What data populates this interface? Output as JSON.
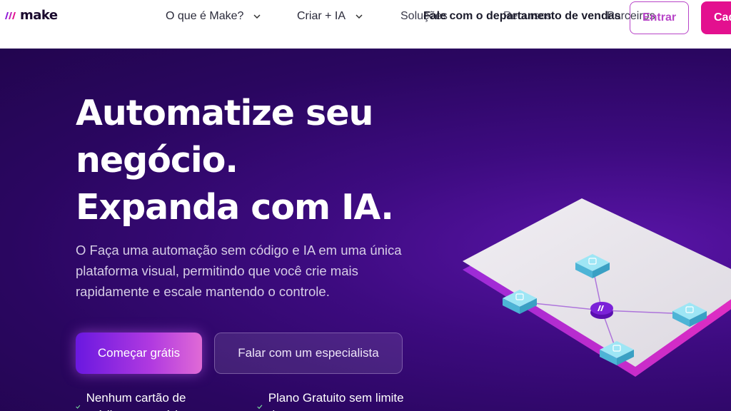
{
  "header": {
    "logo_text": "make",
    "nav": [
      {
        "label": "O que é Make?"
      },
      {
        "label": "Criar + IA"
      }
    ],
    "overlapping_nav": {
      "solucoes": "Soluções",
      "recursos": "Recursos",
      "parceiros": "Parceiros",
      "fale": "Fale com o departamento de vendas",
      "mais": "Entrar"
    },
    "login_label": "Entrar",
    "signup_label": "Cadastre-se"
  },
  "hero": {
    "title": "Automatize seu negócio. Expanda com IA.",
    "lead": "O Faça uma automação sem código e IA em uma única plataforma visual, permitindo que você crie mais rapidamente e escale mantendo o controle.",
    "primary_button": "Começar grátis",
    "secondary_button": "Falar com um especialista",
    "checks": [
      {
        "text": "Nenhum cartão de crédito necessário"
      },
      {
        "text": "Plano Gratuito sem limite de tempo"
      }
    ]
  },
  "colors": {
    "brand_pink": "#e3108f",
    "hero_purple": "#3d0b80",
    "node_blue": "#7fd3ea"
  },
  "icons": [
    "make-logo-icon",
    "chevron-down-icon",
    "checkmark-icon",
    "app-module-icon",
    "make-hub-icon"
  ]
}
